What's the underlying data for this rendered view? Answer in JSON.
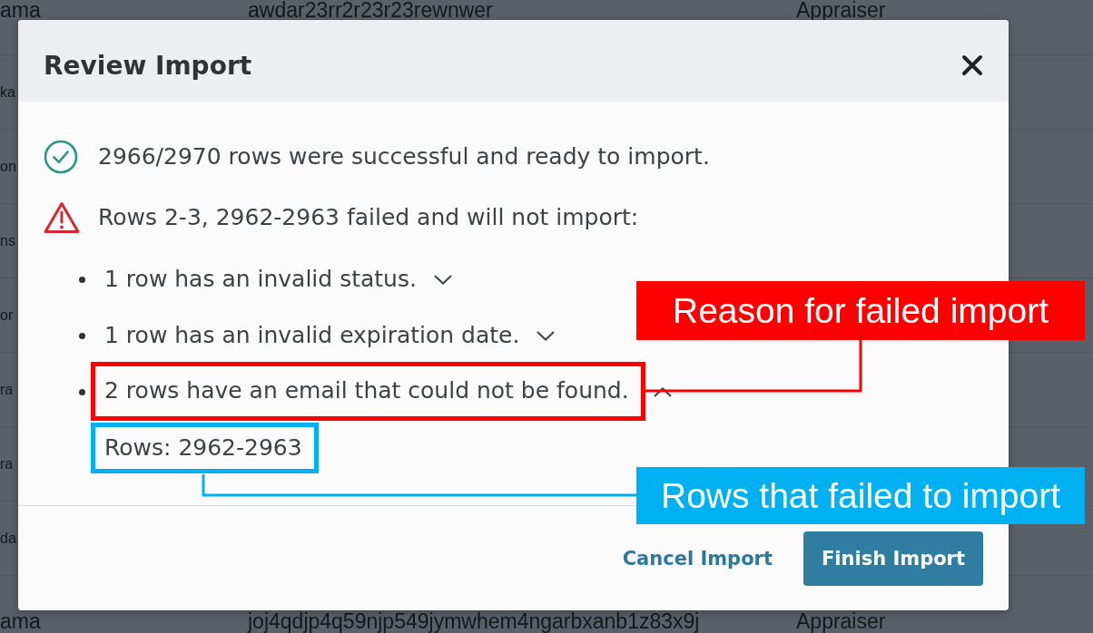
{
  "background_table": {
    "rows": [
      {
        "cells": [
          "ama",
          "awdar23rr2r23r23rewnwer",
          "Appraiser"
        ]
      },
      {
        "cells": [
          "ka"
        ]
      },
      {
        "cells": [
          "on"
        ]
      },
      {
        "cells": [
          "ns"
        ]
      },
      {
        "cells": [
          "or"
        ]
      },
      {
        "cells": [
          "ra"
        ]
      },
      {
        "cells": [
          "ra"
        ]
      },
      {
        "cells": [
          "da"
        ]
      },
      {
        "cells": [
          "ama",
          "joj4qdjp4q59njp549jymwhem4ngarbxanb1z83x9j",
          "Appraiser"
        ]
      }
    ]
  },
  "dialog": {
    "title": "Review Import",
    "messages": [
      {
        "kind": "success",
        "text": "2966/2970 rows were successful and ready to import."
      },
      {
        "kind": "error",
        "text": "Rows 2-3, 2962-2963 failed and will not import:"
      }
    ],
    "reasons": [
      {
        "text": "1 row has an invalid status.",
        "expanded": false
      },
      {
        "text": "1 row has an invalid expiration date.",
        "expanded": false
      },
      {
        "text": "2 rows have an email that could not be found.",
        "expanded": true,
        "annotation": {
          "label": "Reason for failed import",
          "color": "#ff0000"
        },
        "detail": {
          "text": "Rows: 2962-2963",
          "annotation": {
            "label": "Rows that failed to import",
            "color": "#00b0f0"
          }
        }
      }
    ],
    "buttons": [
      {
        "kind": "link",
        "label": "Cancel Import"
      },
      {
        "kind": "primary",
        "label": "Finish Import"
      }
    ]
  }
}
